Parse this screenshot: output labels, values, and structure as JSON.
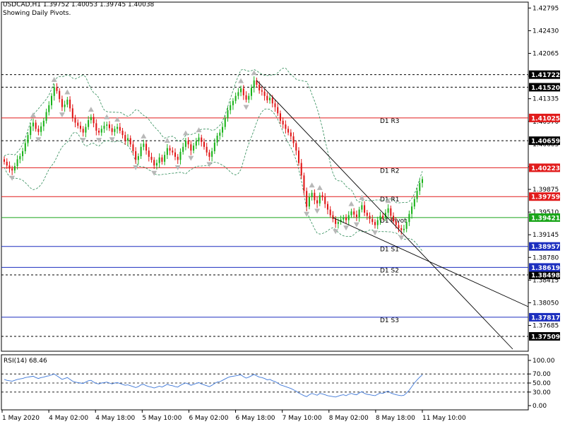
{
  "header": {
    "symbol_line": "USDCAD,H1  1.39752 1.40053 1.39745 1.40038",
    "subtitle": "Showing Daily Pivots."
  },
  "rsi_panel": {
    "label": "RSI(14) 68.46",
    "levels": [
      70,
      50,
      30
    ],
    "ticks": [
      "100.00",
      "70.00",
      "50.00",
      "30.00",
      "0.00"
    ],
    "current_value": 68.46
  },
  "colors": {
    "resistance": "#e11b1b",
    "support": "#1c2fbf",
    "pivot": "#1aa51a",
    "bull_candle": "#19b219",
    "bear_candle": "#e01414",
    "envelope": "#2e8b57",
    "rsi_line": "#3f78d8",
    "trend_line": "#000000",
    "price_tag_bg": "#000000",
    "resistance_tag_bg": "#e11b1b",
    "support_tag_bg": "#1c2fbf",
    "pivot_tag_bg": "#1aa51a"
  },
  "chart_data": {
    "type": "candlestick",
    "title": "USDCAD,H1",
    "ylim": [
      1.3727,
      1.4289
    ],
    "y_ticks": [
      "1.42795",
      "1.42430",
      "1.42065",
      "1.41700",
      "1.41335",
      "1.40970",
      "1.40605",
      "1.40240",
      "1.39875",
      "1.39510",
      "1.39145",
      "1.38780",
      "1.38415",
      "1.38050",
      "1.37685"
    ],
    "x_labels": [
      "1 May 2020",
      "4 May 02:00",
      "4 May 18:00",
      "5 May 10:00",
      "6 May 02:00",
      "6 May 18:00",
      "7 May 10:00",
      "8 May 02:00",
      "8 May 18:00",
      "11 May 10:00"
    ],
    "horizontal_levels": [
      {
        "name": "D1 R3",
        "value": "1.41025",
        "kind": "resistance"
      },
      {
        "name": "D1 R2",
        "value": "1.40223",
        "kind": "resistance"
      },
      {
        "name": "D1 R1",
        "value": "1.39759",
        "kind": "resistance"
      },
      {
        "name": "D1 Pivot",
        "value": "1.39421",
        "kind": "pivot"
      },
      {
        "name": "D1 S1",
        "value": "1.38957",
        "kind": "support"
      },
      {
        "name": "D1 S2",
        "value": "1.38619",
        "kind": "support"
      },
      {
        "name": "D1 S3",
        "value": "1.37817",
        "kind": "support"
      }
    ],
    "dotted_levels": [
      "1.41722",
      "1.41520",
      "1.40659",
      "1.38498",
      "1.37509"
    ],
    "current_price": 1.40038,
    "close_series": [
      1.4032,
      1.4026,
      1.4021,
      1.4018,
      1.4025,
      1.4036,
      1.4041,
      1.4049,
      1.4062,
      1.4075,
      1.4089,
      1.4095,
      1.4085,
      1.408,
      1.4089,
      1.4098,
      1.4112,
      1.4123,
      1.4138,
      1.4152,
      1.4146,
      1.4133,
      1.412,
      1.4124,
      1.4132,
      1.4118,
      1.4103,
      1.4095,
      1.409,
      1.4085,
      1.4079,
      1.4088,
      1.4099,
      1.4104,
      1.4094,
      1.4082,
      1.4079,
      1.4085,
      1.409,
      1.4092,
      1.4086,
      1.408,
      1.4085,
      1.4088,
      1.4082,
      1.4075,
      1.4066,
      1.407,
      1.406,
      1.4049,
      1.4035,
      1.4041,
      1.4056,
      1.4061,
      1.405,
      1.404,
      1.4035,
      1.4026,
      1.403,
      1.4039,
      1.4032,
      1.4043,
      1.4054,
      1.405,
      1.4047,
      1.404,
      1.4035,
      1.4048,
      1.4056,
      1.4066,
      1.406,
      1.405,
      1.4058,
      1.4065,
      1.4071,
      1.4064,
      1.4056,
      1.4047,
      1.404,
      1.4049,
      1.4063,
      1.4074,
      1.4079,
      1.4088,
      1.4102,
      1.4115,
      1.4123,
      1.413,
      1.4138,
      1.4144,
      1.415,
      1.4139,
      1.4132,
      1.4138,
      1.4151,
      1.4163,
      1.4156,
      1.4147,
      1.4145,
      1.4138,
      1.4131,
      1.4135,
      1.4126,
      1.412,
      1.411,
      1.4098,
      1.4092,
      1.4085,
      1.4079,
      1.4073,
      1.4062,
      1.405,
      1.403,
      1.401,
      1.3985,
      1.396,
      1.3975,
      1.3982,
      1.397,
      1.3965,
      1.3978,
      1.3975,
      1.3964,
      1.3955,
      1.3946,
      1.394,
      1.3932,
      1.3935,
      1.3939,
      1.3942,
      1.3938,
      1.3946,
      1.3952,
      1.3947,
      1.3943,
      1.3955,
      1.3962,
      1.395,
      1.3945,
      1.394,
      1.3935,
      1.393,
      1.3938,
      1.3945,
      1.3942,
      1.395,
      1.3957,
      1.3945,
      1.3936,
      1.393,
      1.3925,
      1.3922,
      1.3924,
      1.3935,
      1.3948,
      1.396,
      1.3972,
      1.3985,
      1.3998,
      1.4004
    ],
    "rsi_series": [
      58,
      56,
      55,
      54,
      56,
      58,
      59,
      60,
      62,
      63,
      64,
      65,
      62,
      60,
      62,
      63,
      65,
      66,
      68,
      70,
      66,
      62,
      58,
      60,
      62,
      58,
      54,
      52,
      51,
      50,
      49,
      52,
      55,
      56,
      52,
      49,
      48,
      50,
      51,
      52,
      50,
      48,
      50,
      51,
      49,
      47,
      45,
      46,
      44,
      42,
      40,
      42,
      46,
      47,
      44,
      42,
      41,
      39,
      41,
      43,
      41,
      44,
      47,
      45,
      44,
      42,
      41,
      45,
      48,
      50,
      48,
      45,
      47,
      49,
      51,
      48,
      46,
      44,
      42,
      45,
      49,
      52,
      53,
      56,
      59,
      62,
      64,
      65,
      66,
      67,
      68,
      64,
      61,
      63,
      66,
      69,
      66,
      63,
      62,
      60,
      57,
      58,
      55,
      53,
      50,
      46,
      44,
      42,
      40,
      38,
      35,
      32,
      28,
      25,
      22,
      20,
      24,
      27,
      25,
      23,
      27,
      26,
      24,
      22,
      21,
      20,
      19,
      21,
      23,
      24,
      22,
      25,
      27,
      25,
      24,
      28,
      31,
      27,
      25,
      24,
      23,
      22,
      25,
      28,
      27,
      30,
      32,
      28,
      26,
      24,
      23,
      22,
      23,
      28,
      34,
      42,
      50,
      57,
      63,
      68
    ]
  }
}
